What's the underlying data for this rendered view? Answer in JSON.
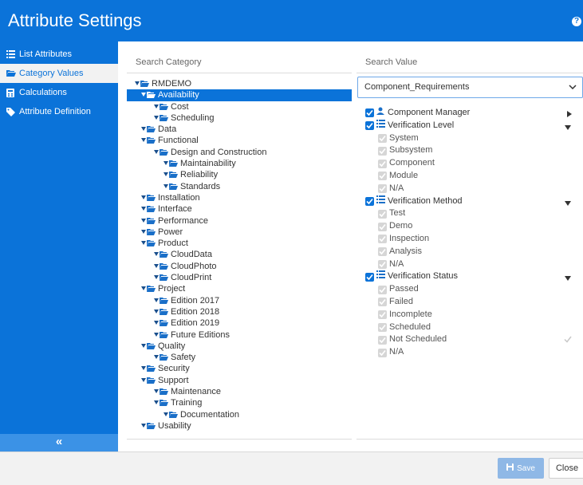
{
  "app": {
    "title": "Attribute Settings",
    "help_icon": "help-circle-icon"
  },
  "sidebar": {
    "items": [
      {
        "label": "List Attributes",
        "icon": "list-icon",
        "active": false
      },
      {
        "label": "Category Values",
        "icon": "folder-icon",
        "active": true
      },
      {
        "label": "Calculations",
        "icon": "calculator-icon",
        "active": false
      },
      {
        "label": "Attribute Definition",
        "icon": "tag-icon",
        "active": false
      }
    ],
    "collapse_label": "«"
  },
  "category": {
    "header": "Search Category",
    "tree": [
      {
        "label": "RMDEMO",
        "depth": 0,
        "selected": false
      },
      {
        "label": "Availability",
        "depth": 1,
        "selected": true
      },
      {
        "label": "Cost",
        "depth": 2,
        "selected": false
      },
      {
        "label": "Scheduling",
        "depth": 2,
        "selected": false
      },
      {
        "label": "Data",
        "depth": 1,
        "selected": false
      },
      {
        "label": "Functional",
        "depth": 1,
        "selected": false
      },
      {
        "label": "Design and Construction",
        "depth": 2,
        "selected": false
      },
      {
        "label": "Maintainability",
        "depth": 3,
        "selected": false
      },
      {
        "label": "Reliability",
        "depth": 3,
        "selected": false
      },
      {
        "label": "Standards",
        "depth": 3,
        "selected": false
      },
      {
        "label": "Installation",
        "depth": 1,
        "selected": false
      },
      {
        "label": "Interface",
        "depth": 1,
        "selected": false
      },
      {
        "label": "Performance",
        "depth": 1,
        "selected": false
      },
      {
        "label": "Power",
        "depth": 1,
        "selected": false
      },
      {
        "label": "Product",
        "depth": 1,
        "selected": false
      },
      {
        "label": "CloudData",
        "depth": 2,
        "selected": false
      },
      {
        "label": "CloudPhoto",
        "depth": 2,
        "selected": false
      },
      {
        "label": "CloudPrint",
        "depth": 2,
        "selected": false
      },
      {
        "label": "Project",
        "depth": 1,
        "selected": false
      },
      {
        "label": "Edition 2017",
        "depth": 2,
        "selected": false
      },
      {
        "label": "Edition 2018",
        "depth": 2,
        "selected": false
      },
      {
        "label": "Edition 2019",
        "depth": 2,
        "selected": false
      },
      {
        "label": "Future Editions",
        "depth": 2,
        "selected": false
      },
      {
        "label": "Quality",
        "depth": 1,
        "selected": false
      },
      {
        "label": "Safety",
        "depth": 2,
        "selected": false
      },
      {
        "label": "Security",
        "depth": 1,
        "selected": false
      },
      {
        "label": "Support",
        "depth": 1,
        "selected": false
      },
      {
        "label": "Maintenance",
        "depth": 2,
        "selected": false
      },
      {
        "label": "Training",
        "depth": 2,
        "selected": false
      },
      {
        "label": "Documentation",
        "depth": 3,
        "selected": false
      },
      {
        "label": "Usability",
        "depth": 1,
        "selected": false
      }
    ]
  },
  "values": {
    "header": "Search Value",
    "selected_requirement": "Component_Requirements",
    "rows": [
      {
        "type": "attr",
        "label": "Component Manager",
        "icon": "user-icon",
        "arrow": "right"
      },
      {
        "type": "attr",
        "label": "Verification Level",
        "icon": "list-icon",
        "arrow": "down"
      },
      {
        "type": "value",
        "label": "System"
      },
      {
        "type": "value",
        "label": "Subsystem"
      },
      {
        "type": "value",
        "label": "Component"
      },
      {
        "type": "value",
        "label": "Module"
      },
      {
        "type": "value",
        "label": "N/A"
      },
      {
        "type": "attr",
        "label": "Verification Method",
        "icon": "list-icon",
        "arrow": "down"
      },
      {
        "type": "value",
        "label": "Test"
      },
      {
        "type": "value",
        "label": "Demo"
      },
      {
        "type": "value",
        "label": "Inspection"
      },
      {
        "type": "value",
        "label": "Analysis"
      },
      {
        "type": "value",
        "label": "N/A"
      },
      {
        "type": "attr",
        "label": "Verification Status",
        "icon": "list-icon",
        "arrow": "down"
      },
      {
        "type": "value",
        "label": "Passed"
      },
      {
        "type": "value",
        "label": "Failed"
      },
      {
        "type": "value",
        "label": "Incomplete"
      },
      {
        "type": "value",
        "label": "Scheduled"
      },
      {
        "type": "value",
        "label": "Not Scheduled",
        "trailing_check": true
      },
      {
        "type": "value",
        "label": "N/A"
      }
    ]
  },
  "footer": {
    "save_label": "Save",
    "close_label": "Close",
    "save_icon": "floppy-disk-icon"
  },
  "colors": {
    "accent": "#0b73d9",
    "sidebar_bg": "#0b73d9",
    "save_disabled": "#8fb8e6"
  }
}
